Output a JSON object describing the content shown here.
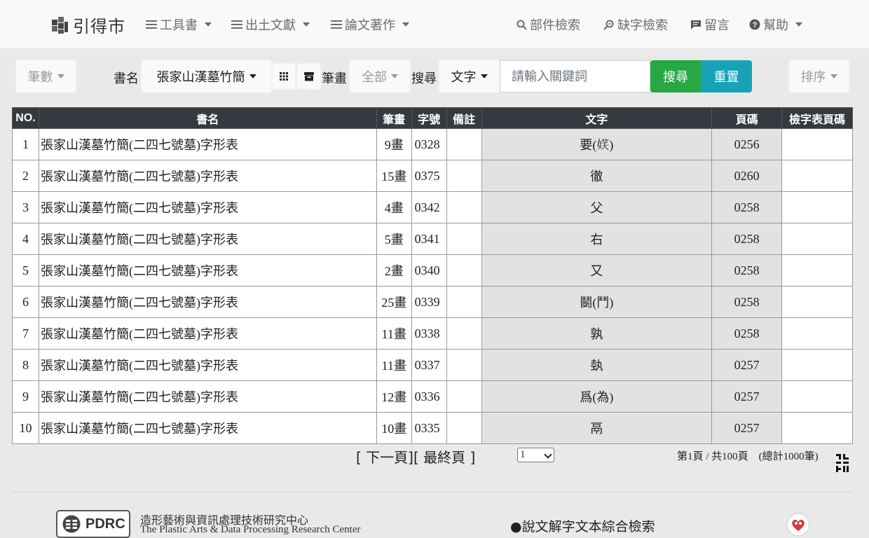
{
  "navbar": {
    "brand": "引得市",
    "menu": [
      {
        "label": "工具書"
      },
      {
        "label": "出土文獻"
      },
      {
        "label": "論文著作"
      }
    ],
    "right": [
      {
        "label": "部件檢索"
      },
      {
        "label": "缺字檢索"
      },
      {
        "label": "留言"
      },
      {
        "label": "幫助"
      }
    ]
  },
  "toolbar": {
    "strokes_count": "筆數",
    "book_label": "書名",
    "book_value": "張家山漢墓竹簡",
    "stroke_label": "筆畫",
    "stroke_value": "全部",
    "search_label": "搜尋",
    "search_type": "文字",
    "search_placeholder": "請輸入關鍵詞",
    "search_button": "搜尋",
    "reset_button": "重置",
    "sort_button": "排序"
  },
  "table": {
    "headers": [
      "NO.",
      "書名",
      "筆畫",
      "字號",
      "備註",
      "文字",
      "頁碼",
      "檢字表頁碼"
    ],
    "rows": [
      {
        "no": "1",
        "book": "張家山漢墓竹簡(二四七號墓)字形表",
        "strokes": "9畫",
        "code": "0328",
        "note": "",
        "char": "要(𡝩)",
        "page": "0256",
        "index_page": ""
      },
      {
        "no": "2",
        "book": "張家山漢墓竹簡(二四七號墓)字形表",
        "strokes": "15畫",
        "code": "0375",
        "note": "",
        "char": "徹",
        "page": "0260",
        "index_page": ""
      },
      {
        "no": "3",
        "book": "張家山漢墓竹簡(二四七號墓)字形表",
        "strokes": "4畫",
        "code": "0342",
        "note": "",
        "char": "父",
        "page": "0258",
        "index_page": ""
      },
      {
        "no": "4",
        "book": "張家山漢墓竹簡(二四七號墓)字形表",
        "strokes": "5畫",
        "code": "0341",
        "note": "",
        "char": "右",
        "page": "0258",
        "index_page": ""
      },
      {
        "no": "5",
        "book": "張家山漢墓竹簡(二四七號墓)字形表",
        "strokes": "2畫",
        "code": "0340",
        "note": "",
        "char": "又",
        "page": "0258",
        "index_page": ""
      },
      {
        "no": "6",
        "book": "張家山漢墓竹簡(二四七號墓)字形表",
        "strokes": "25畫",
        "code": "0339",
        "note": "",
        "char": "鬭(鬥)",
        "page": "0258",
        "index_page": ""
      },
      {
        "no": "7",
        "book": "張家山漢墓竹簡(二四七號墓)字形表",
        "strokes": "11畫",
        "code": "0338",
        "note": "",
        "char": "孰",
        "page": "0258",
        "index_page": ""
      },
      {
        "no": "8",
        "book": "張家山漢墓竹簡(二四七號墓)字形表",
        "strokes": "11畫",
        "code": "0337",
        "note": "",
        "char": "埶",
        "page": "0257",
        "index_page": ""
      },
      {
        "no": "9",
        "book": "張家山漢墓竹簡(二四七號墓)字形表",
        "strokes": "12畫",
        "code": "0336",
        "note": "",
        "char": "爲(為)",
        "page": "0257",
        "index_page": ""
      },
      {
        "no": "10",
        "book": "張家山漢墓竹簡(二四七號墓)字形表",
        "strokes": "10畫",
        "code": "0335",
        "note": "",
        "char": "鬲",
        "page": "0257",
        "index_page": ""
      }
    ]
  },
  "pagination": {
    "next": "[ 下一頁]",
    "last": "[ 最終頁 ]",
    "current": "1",
    "info": "第1頁 / 共100頁　(總計1000筆)"
  },
  "footer": {
    "logo_text": "PDRC",
    "org_cn": "造形藝術與資訊處理技術研究中心",
    "org_en": "The Plastic Arts & Data Processing Research Center",
    "link": "●說文解字文本綜合檢索"
  },
  "colors": {
    "green": "#28a745",
    "cyan": "#17a2b8",
    "header": "#343a40"
  }
}
